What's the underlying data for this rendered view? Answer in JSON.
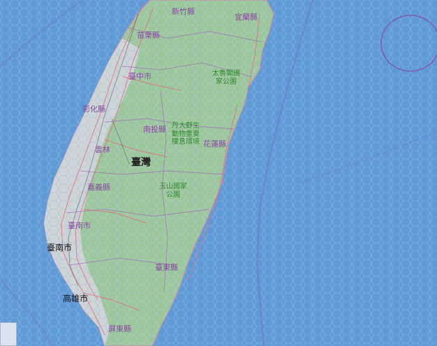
{
  "map": {
    "island_label": "臺灣",
    "county_labels": [
      {
        "id": "hsinchu",
        "text": "新竹縣"
      },
      {
        "id": "yilan",
        "text": "宜蘭縣"
      },
      {
        "id": "miaoli",
        "text": "苗栗縣"
      },
      {
        "id": "taichung",
        "text": "臺中市"
      },
      {
        "id": "changhua",
        "text": "彰化縣"
      },
      {
        "id": "nantou",
        "text": "南投縣"
      },
      {
        "id": "hualien",
        "text": "花蓮縣"
      },
      {
        "id": "yunlin",
        "text": "雲林"
      },
      {
        "id": "chiayi",
        "text": "嘉義縣"
      },
      {
        "id": "tainan-county",
        "text": "臺南市"
      },
      {
        "id": "taitung",
        "text": "臺東縣"
      },
      {
        "id": "pingtung",
        "text": "屏東縣"
      }
    ],
    "park_labels": [
      {
        "id": "taroko-1",
        "text": "太魯閣國"
      },
      {
        "id": "taroko-2",
        "text": "家公園"
      },
      {
        "id": "dan-1",
        "text": "丹大野生"
      },
      {
        "id": "dan-2",
        "text": "動物重要"
      },
      {
        "id": "dan-3",
        "text": "棲息環境"
      },
      {
        "id": "yushan-1",
        "text": "玉山國家"
      },
      {
        "id": "yushan-2",
        "text": "公園"
      }
    ],
    "city_labels": [
      {
        "id": "tainan",
        "text": "臺南市"
      },
      {
        "id": "kaohsiung",
        "text": "高雄市"
      }
    ],
    "colors": {
      "sea": "#5d9ad6",
      "land": "#9cc79a",
      "coast_plain": "#d2d6de",
      "mesh": "#8fb2e0",
      "roads": "#e06f7f",
      "county_border": "#8a4aa0",
      "park": "#2e8b2e"
    }
  }
}
